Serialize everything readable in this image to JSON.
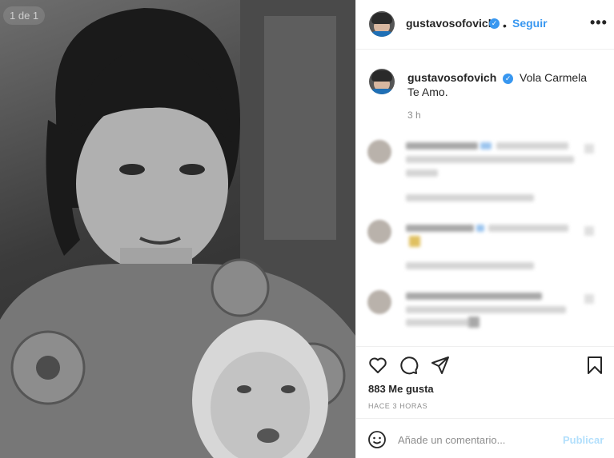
{
  "photo": {
    "counter": "1 de 1",
    "alt": "photo"
  },
  "header": {
    "username": "gustavosofovich",
    "verified_glyph": "✓",
    "separator": "•",
    "follow_label": "Seguir",
    "more_label": "•••"
  },
  "caption": {
    "username": "gustavosofovich",
    "verified_glyph": "✓",
    "text": "Vola Carmela Te Amo.",
    "time": "3 h"
  },
  "comments": [
    {
      "blurred": true
    },
    {
      "blurred": true
    },
    {
      "blurred": true
    }
  ],
  "actions": {
    "like_icon": "heart-icon",
    "comment_icon": "comment-bubble-icon",
    "share_icon": "paper-plane-icon",
    "save_icon": "bookmark-icon",
    "likes": "883 Me gusta",
    "posted_ago": "HACE 3 HORAS"
  },
  "add_comment": {
    "placeholder": "Añade un comentario...",
    "publish_label": "Publicar"
  },
  "colors": {
    "accent": "#3897f0",
    "publish_disabled": "#b2dffc",
    "muted": "#8e8e8e"
  }
}
